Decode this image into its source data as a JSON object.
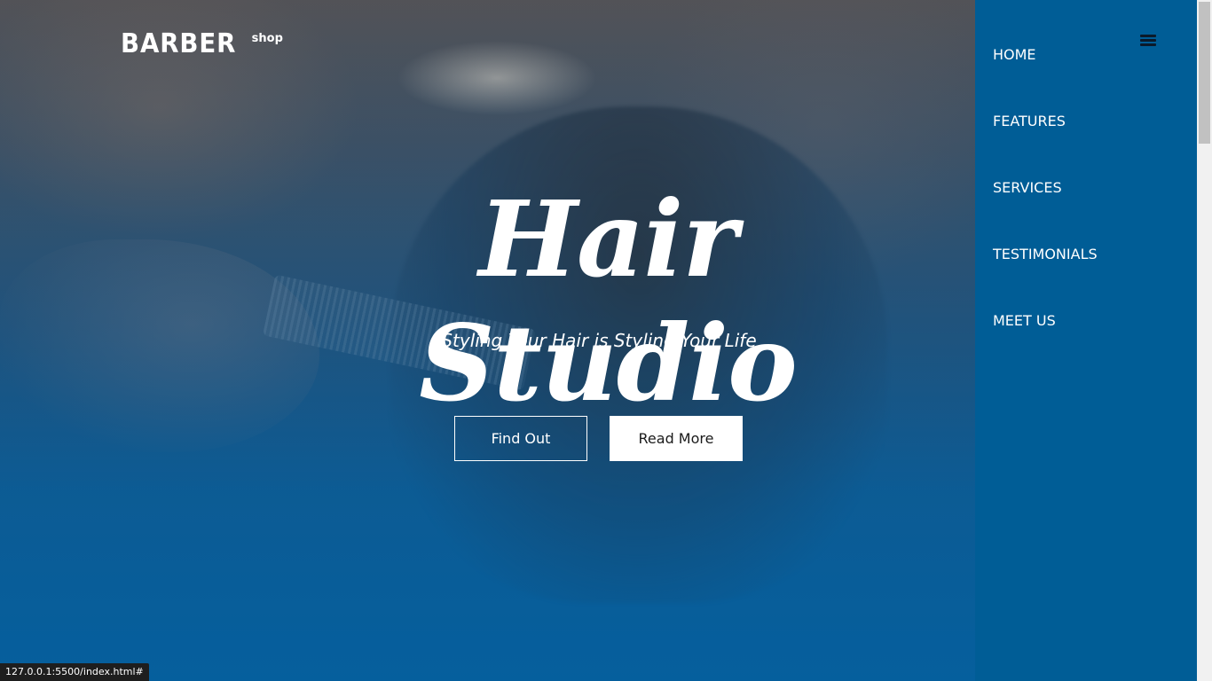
{
  "logo": {
    "main": "BARBER",
    "sub": "shop"
  },
  "hero": {
    "title": "Hair Studio",
    "subtitle": "Styling Your Hair is Styling Your Life",
    "buttons": {
      "primary": "Find Out",
      "secondary": "Read More"
    }
  },
  "nav": {
    "menu_icon": "hamburger-icon",
    "items": [
      {
        "label": "HOME"
      },
      {
        "label": "FEATURES"
      },
      {
        "label": "SERVICES"
      },
      {
        "label": "TESTIMONIALS"
      },
      {
        "label": "MEET US"
      }
    ]
  },
  "status_bar": {
    "url": "127.0.0.1:5500/index.html#"
  },
  "colors": {
    "sidebar": "#005d96",
    "hero_overlay": "#0b5f9a",
    "text": "#ffffff",
    "button_text_dark": "#1a1a1a"
  }
}
